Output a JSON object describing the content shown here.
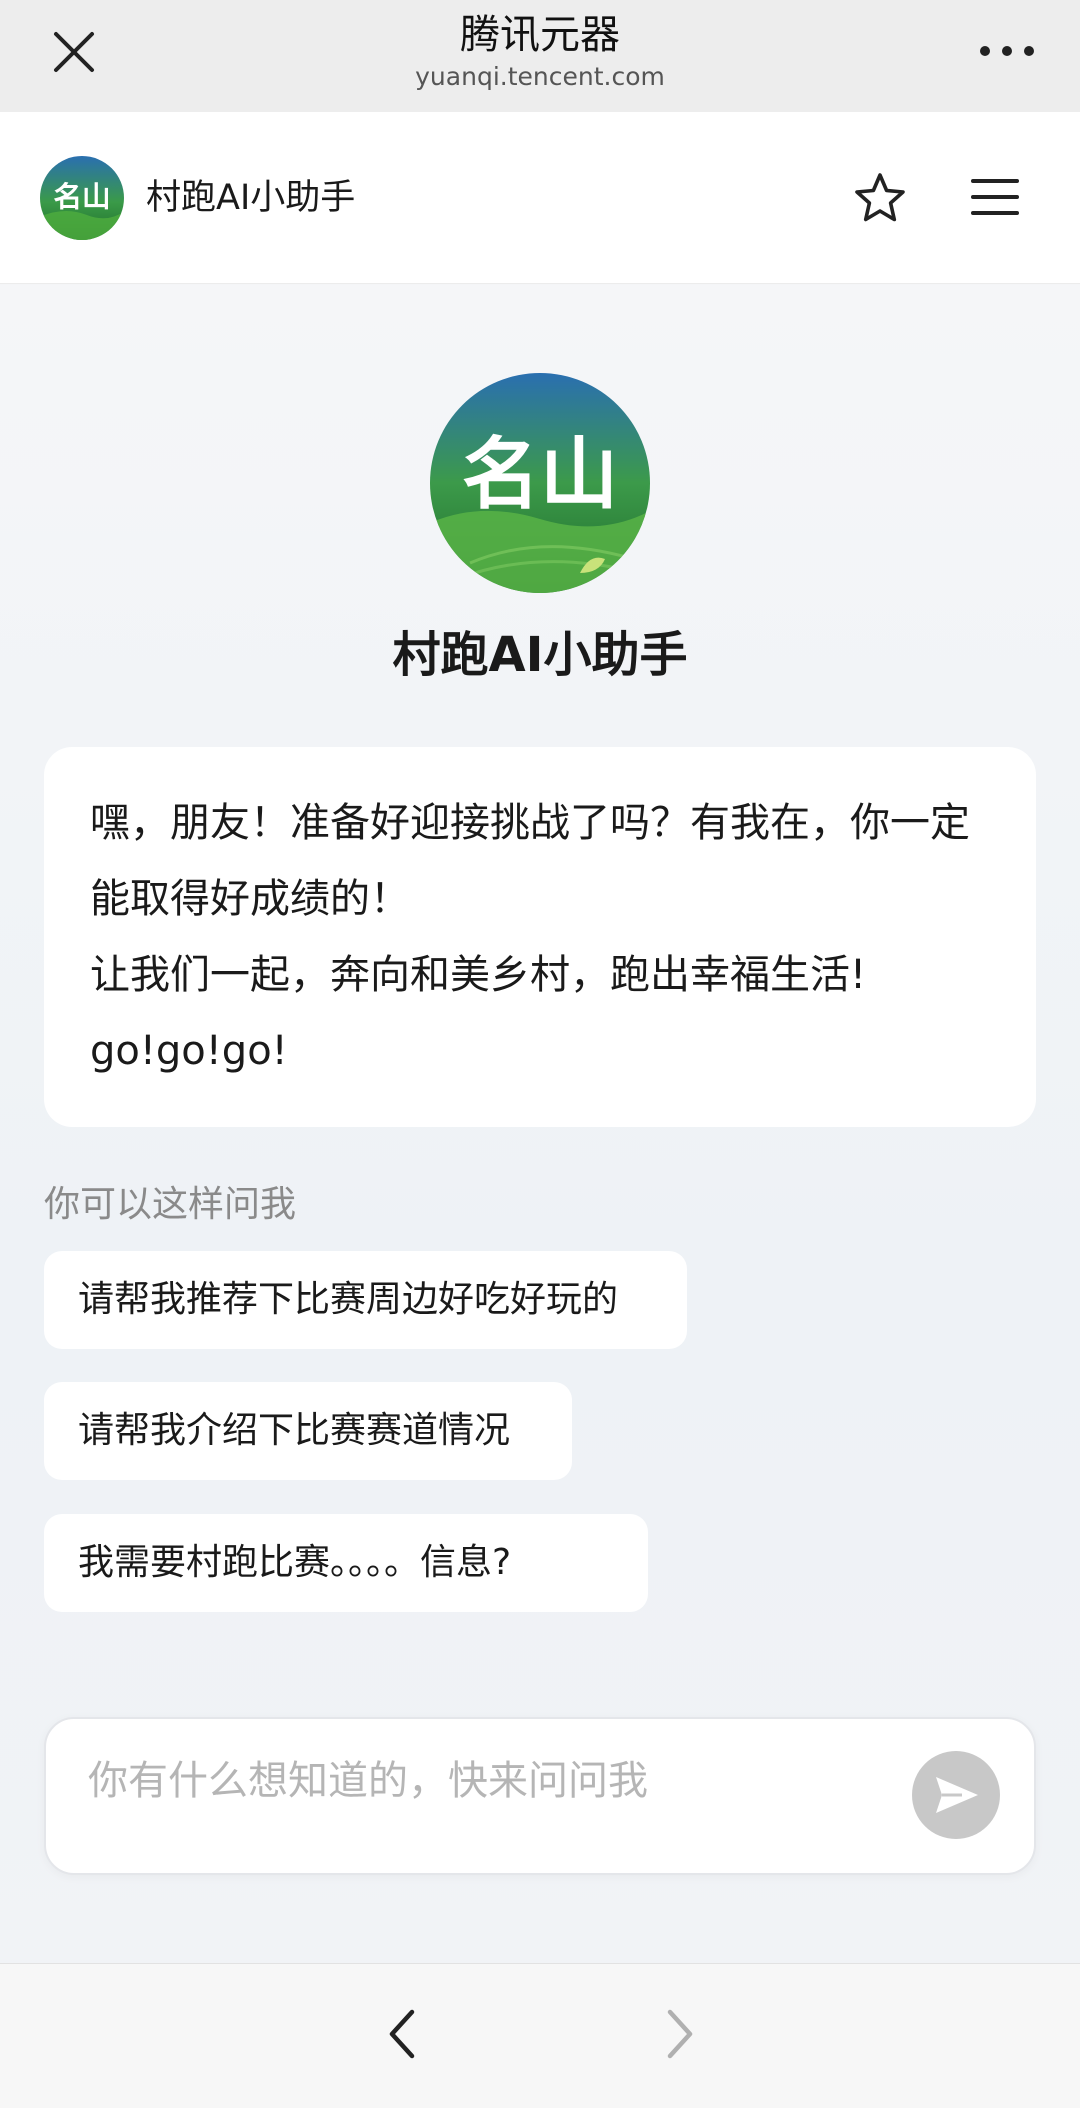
{
  "browser": {
    "title": "腾讯元器",
    "url": "yuanqi.tencent.com",
    "close_icon": "close-icon",
    "more_icon": "more-dots-icon"
  },
  "app_header": {
    "logo_text": "名山",
    "name": "村跑AI小助手",
    "star_icon": "star-icon",
    "menu_icon": "menu-icon"
  },
  "hero": {
    "avatar_text": "名山",
    "name": "村跑AI小助手"
  },
  "greeting": {
    "line1": "嘿，朋友！准备好迎接挑战了吗？有我在，你一定能取得好成绩的！",
    "line2": "让我们一起，奔向和美乡村，跑出幸福生活!",
    "line3": "go!go!go!"
  },
  "suggestions": {
    "hint": "你可以这样问我",
    "items": [
      "请帮我推荐下比赛周边好吃好玩的",
      "请帮我介绍下比赛赛道情况",
      "我需要村跑比赛。。。。信息?"
    ]
  },
  "input": {
    "placeholder": "你有什么想知道的，快来问问我",
    "value": "",
    "send_icon": "send-icon"
  },
  "bottom_nav": {
    "back_icon": "chevron-left-icon",
    "forward_icon": "chevron-right-icon"
  },
  "colors": {
    "logo_green": "#2f8a3a",
    "logo_blue": "#2a6fb0",
    "send_disabled": "#c8c8c8"
  }
}
